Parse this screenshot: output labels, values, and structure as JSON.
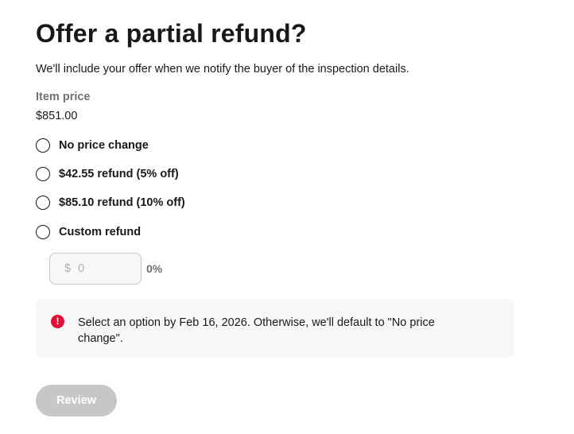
{
  "header": {
    "title": "Offer a partial refund?",
    "subtitle": "We'll include your offer when we notify the buyer of the inspection details."
  },
  "item_price": {
    "label": "Item price",
    "value": "$851.00"
  },
  "options": [
    {
      "label": "No price change",
      "selected": false
    },
    {
      "label": "$42.55 refund (5% off)",
      "selected": false
    },
    {
      "label": "$85.10 refund (10% off)",
      "selected": false
    },
    {
      "label": "Custom refund",
      "selected": false
    }
  ],
  "custom_refund": {
    "currency_symbol": "$",
    "placeholder": "0",
    "percent": "0%"
  },
  "notice": {
    "icon": "alert-circle-icon",
    "icon_glyph": "!",
    "text": "Select an option by Feb 16, 2026. Otherwise, we'll default to \"No price change\"."
  },
  "actions": {
    "review_label": "Review",
    "review_enabled": false
  },
  "colors": {
    "text": "#191919",
    "muted": "#707070",
    "alert": "#e0103a",
    "disabled_button": "#c7c7c7",
    "notice_bg": "#f7f7f7"
  }
}
